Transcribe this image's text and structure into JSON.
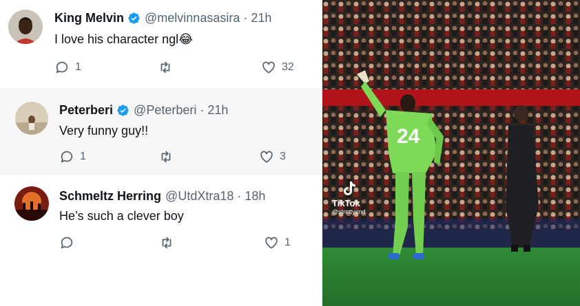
{
  "replies": [
    {
      "name": "King Melvin",
      "handle": "@melvinnasasira",
      "separator": "·",
      "time": "21h",
      "text": "I love his character ngl",
      "emoji": "😂",
      "verified": true,
      "reply_count": "1",
      "like_count": "32"
    },
    {
      "name": "Peterberi",
      "handle": "@Peterberi",
      "separator": "·",
      "time": "21h",
      "text": "Very funny guy!!",
      "verified": true,
      "reply_count": "1",
      "like_count": "3"
    },
    {
      "name": "Schmeltz Herring",
      "handle": "@UtdXtra18",
      "separator": "·",
      "time": "18h",
      "text": "He’s such a clever boy",
      "verified": false,
      "reply_count": "",
      "like_count": "1"
    }
  ],
  "video": {
    "watermark": "TikTok",
    "watermark_handle": "@strettyend",
    "jersey_number": "24"
  },
  "colors": {
    "verified_badge": "#1d9bf0",
    "secondary_text": "#536471",
    "keeper_kit": "#7ed957",
    "pitch": "#2f8a34"
  }
}
